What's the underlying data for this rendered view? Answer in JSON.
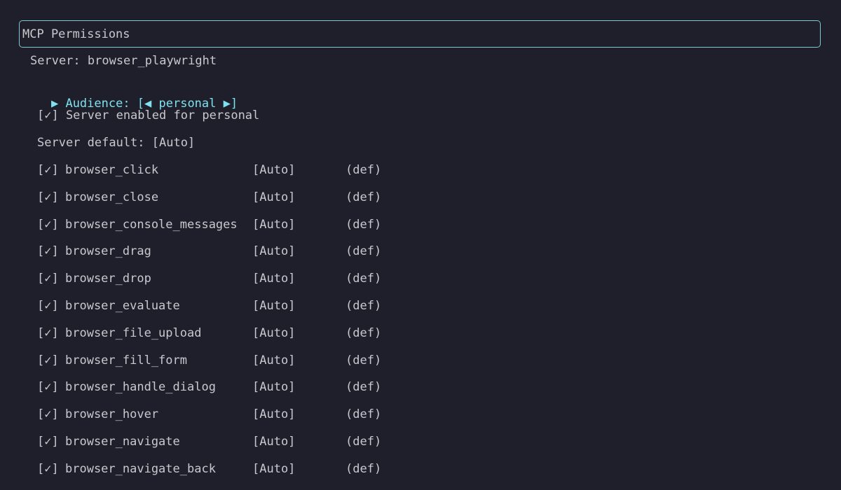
{
  "title": "MCP Permissions",
  "server_line": "Server: browser_playwright",
  "audience": {
    "marker": "▶",
    "label": "Audience: [◀ personal ▶]"
  },
  "enabled_line": "[✓] Server enabled for personal",
  "default_line": "Server default: [Auto]",
  "tools": [
    {
      "check": "[✓]",
      "name": "browser_click",
      "mode": "[Auto]",
      "source": "(def)"
    },
    {
      "check": "[✓]",
      "name": "browser_close",
      "mode": "[Auto]",
      "source": "(def)"
    },
    {
      "check": "[✓]",
      "name": "browser_console_messages",
      "mode": "[Auto]",
      "source": "(def)"
    },
    {
      "check": "[✓]",
      "name": "browser_drag",
      "mode": "[Auto]",
      "source": "(def)"
    },
    {
      "check": "[✓]",
      "name": "browser_drop",
      "mode": "[Auto]",
      "source": "(def)"
    },
    {
      "check": "[✓]",
      "name": "browser_evaluate",
      "mode": "[Auto]",
      "source": "(def)"
    },
    {
      "check": "[✓]",
      "name": "browser_file_upload",
      "mode": "[Auto]",
      "source": "(def)"
    },
    {
      "check": "[✓]",
      "name": "browser_fill_form",
      "mode": "[Auto]",
      "source": "(def)"
    },
    {
      "check": "[✓]",
      "name": "browser_handle_dialog",
      "mode": "[Auto]",
      "source": "(def)"
    },
    {
      "check": "[✓]",
      "name": "browser_hover",
      "mode": "[Auto]",
      "source": "(def)"
    },
    {
      "check": "[✓]",
      "name": "browser_navigate",
      "mode": "[Auto]",
      "source": "(def)"
    },
    {
      "check": "[✓]",
      "name": "browser_navigate_back",
      "mode": "[Auto]",
      "source": "(def)"
    }
  ],
  "colors": {
    "background": "#1e1f2a",
    "text": "#c8c9cf",
    "accent": "#7fe0ee",
    "border": "#7fc8d6"
  }
}
